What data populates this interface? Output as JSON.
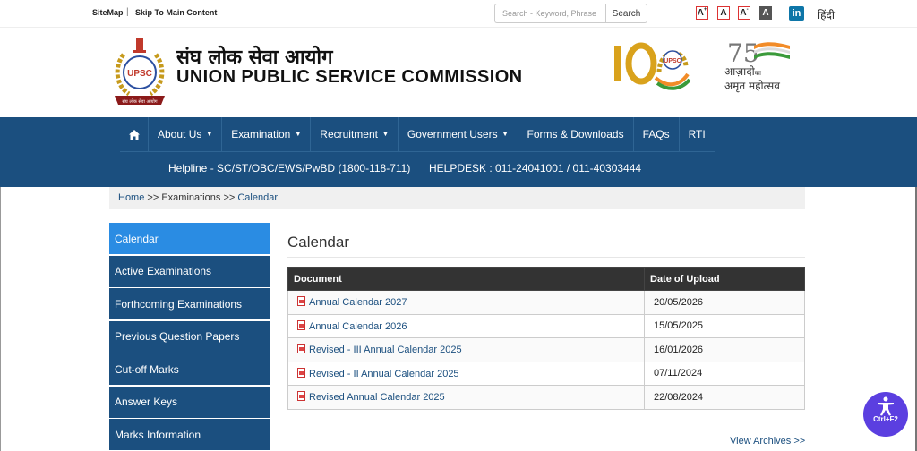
{
  "topbar": {
    "sitemap": "SiteMap",
    "separator": "|",
    "skip": "Skip To Main Content",
    "search_placeholder": "Search - Keyword, Phrase",
    "search_button": "Search",
    "font_sizes": [
      "A",
      "A",
      "A",
      "A"
    ],
    "font_sup_plus": "+",
    "font_sup_minus": "-",
    "linkedin": "in",
    "hindi": "हिंदी"
  },
  "header": {
    "title_hindi": "संघ लोक सेवा आयोग",
    "title_english": "UNION PUBLIC SERVICE COMMISSION",
    "emblem_text": "UPSC",
    "emblem_ribbon": "संघ लोक सेवा आयोग",
    "logo100_text": "UPSC",
    "azadi_line1": "आज़ादी",
    "azadi_ka": "का",
    "azadi_line2": "अमृत महोत्सव",
    "azadi_75": "75"
  },
  "nav": {
    "items": [
      {
        "label": "About Us",
        "dropdown": true
      },
      {
        "label": "Examination",
        "dropdown": true
      },
      {
        "label": "Recruitment",
        "dropdown": true
      },
      {
        "label": "Government Users",
        "dropdown": true
      },
      {
        "label": "Forms & Downloads",
        "dropdown": false
      },
      {
        "label": "FAQs",
        "dropdown": false
      },
      {
        "label": "RTI",
        "dropdown": false
      }
    ],
    "caret": "▼",
    "helpline": "Helpline - SC/ST/OBC/EWS/PwBD (1800-118-711)",
    "helpdesk": "HELPDESK : 011-24041001 / 011-40303444"
  },
  "breadcrumb": {
    "home": "Home",
    "sep1": ">>",
    "examinations": "Examinations",
    "sep2": ">>",
    "current": "Calendar"
  },
  "sidebar": {
    "items": [
      {
        "label": "Calendar",
        "active": true
      },
      {
        "label": "Active Examinations",
        "active": false
      },
      {
        "label": "Forthcoming Examinations",
        "active": false
      },
      {
        "label": "Previous Question Papers",
        "active": false
      },
      {
        "label": "Cut-off Marks",
        "active": false
      },
      {
        "label": "Answer Keys",
        "active": false
      },
      {
        "label": "Marks Information",
        "active": false
      }
    ]
  },
  "main": {
    "title": "Calendar",
    "columns": [
      "Document",
      "Date of Upload"
    ],
    "rows": [
      {
        "document": "Annual Calendar 2027",
        "date": "20/05/2026"
      },
      {
        "document": "Annual Calendar 2026",
        "date": "15/05/2025"
      },
      {
        "document": "Revised - III Annual Calendar 2025",
        "date": "16/01/2026"
      },
      {
        "document": "Revised - II Annual Calendar 2025",
        "date": "07/11/2024"
      },
      {
        "document": "Revised Annual Calendar 2025",
        "date": "22/08/2024"
      }
    ],
    "view_archives": "View Archives >>"
  },
  "accessibility": {
    "label": "Ctrl+F2"
  },
  "colors": {
    "nav_bg": "#1b4f7f",
    "sidebar_active": "#2a8ce3",
    "table_header": "#333333",
    "link": "#1b4f7f"
  }
}
